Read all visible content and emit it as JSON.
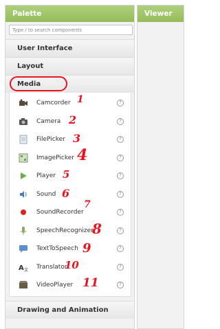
{
  "palette": {
    "title": "Palette",
    "search_placeholder": "Type / to search components",
    "categories": {
      "user_interface": "User Interface",
      "layout": "Layout",
      "media": "Media",
      "drawing": "Drawing and Animation"
    },
    "media_items": [
      {
        "label": "Camcorder",
        "icon": "camcorder-icon",
        "mark": "1"
      },
      {
        "label": "Camera",
        "icon": "camera-icon",
        "mark": "2"
      },
      {
        "label": "FilePicker",
        "icon": "file-picker-icon",
        "mark": "3"
      },
      {
        "label": "ImagePicker",
        "icon": "image-picker-icon",
        "mark": "4"
      },
      {
        "label": "Player",
        "icon": "player-icon",
        "mark": "5"
      },
      {
        "label": "Sound",
        "icon": "sound-icon",
        "mark": "6"
      },
      {
        "label": "SoundRecorder",
        "icon": "sound-recorder-icon",
        "mark": "7"
      },
      {
        "label": "SpeechRecognizer",
        "icon": "speech-recognizer-icon",
        "mark": "8"
      },
      {
        "label": "TextToSpeech",
        "icon": "text-to-speech-icon",
        "mark": "9"
      },
      {
        "label": "Translator",
        "icon": "translator-icon",
        "mark": "10"
      },
      {
        "label": "VideoPlayer",
        "icon": "video-player-icon",
        "mark": "11"
      }
    ],
    "help_glyph": "?"
  },
  "viewer": {
    "title": "Viewer"
  },
  "colors": {
    "header": "#9fc46a",
    "annotation": "#e8131f"
  }
}
